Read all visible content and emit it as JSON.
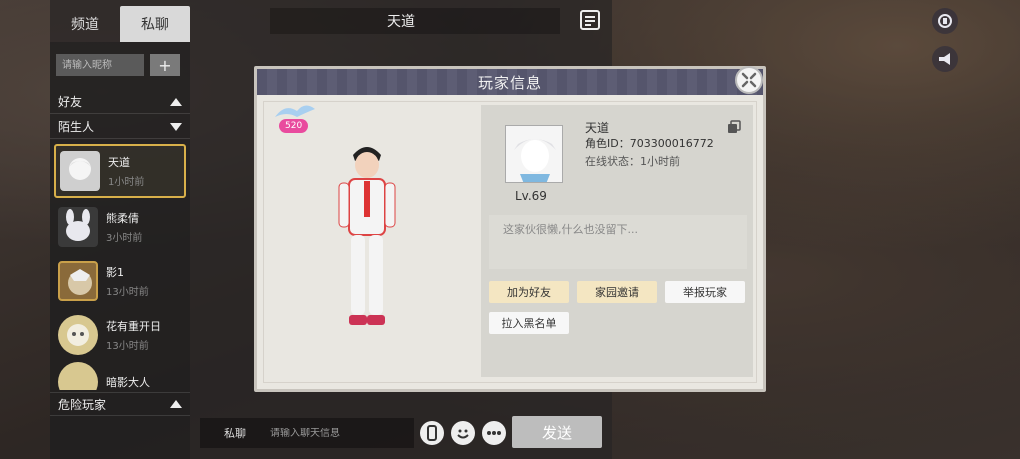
{
  "chat": {
    "tabs": [
      {
        "label": "频道",
        "active": false
      },
      {
        "label": "私聊",
        "active": true
      }
    ],
    "header_title": "天道",
    "search_placeholder": "请输入昵称",
    "add_label": "+",
    "sections": {
      "friends": "好友",
      "strangers": "陌生人",
      "danger": "危险玩家"
    },
    "contacts": [
      {
        "name": "天道",
        "time": "1小时前",
        "selected": true
      },
      {
        "name": "熊柔倩",
        "time": "3小时前",
        "selected": false
      },
      {
        "name": "影1",
        "time": "13小时前",
        "selected": false
      },
      {
        "name": "花有重开日",
        "time": "13小时前",
        "selected": false
      },
      {
        "name": "暗影大人",
        "time": "",
        "selected": false
      }
    ],
    "input_label": "私聊",
    "input_placeholder": "请输入聊天信息",
    "send_label": "发送"
  },
  "dialog": {
    "title": "玩家信息",
    "badge_number": "520",
    "player": {
      "name": "天道",
      "id_line": "角色ID：703300016772",
      "status_line": "在线状态：1小时前",
      "level": "Lv.69",
      "signature": "这家伙很懒,什么也没留下..."
    },
    "buttons": {
      "add_friend": "加为好友",
      "home_invite": "家园邀请",
      "report": "举报玩家",
      "blacklist": "拉入黑名单"
    }
  },
  "colors": {
    "header": "#55556c",
    "selected_border": "#d8b04a",
    "badge": "#e94b9e",
    "yellow_button": "#f4e6c2"
  }
}
